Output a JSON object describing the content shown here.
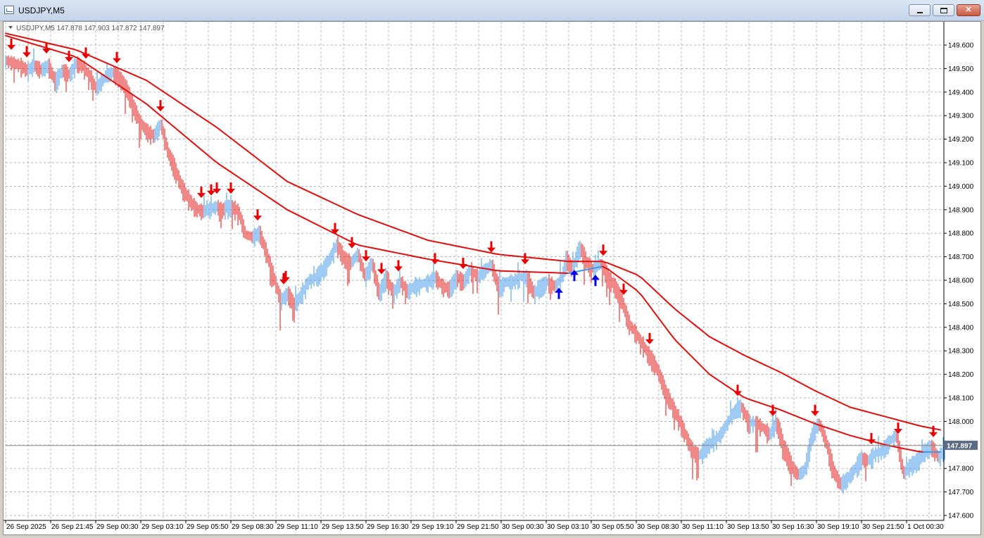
{
  "window": {
    "title": "USDJPY,M5",
    "minimize_label": "‒",
    "maximize_label": "□",
    "close_label": "✕"
  },
  "chart_data": {
    "type": "bar",
    "symbol_info": "USDJPY,M5",
    "ohlc_text": "147.878 147.903 147.872 147.897",
    "bid": "147.897",
    "ylim": [
      147.6,
      149.65
    ],
    "yticks": [
      "149.600",
      "149.500",
      "149.400",
      "149.300",
      "149.200",
      "149.100",
      "149.000",
      "148.900",
      "148.800",
      "148.700",
      "148.600",
      "148.500",
      "148.400",
      "148.300",
      "148.200",
      "148.100",
      "148.000",
      "147.900",
      "147.800",
      "147.700",
      "147.600"
    ],
    "xticks": [
      "26 Sep 2025",
      "26 Sep 21:45",
      "29 Sep 00:30",
      "29 Sep 03:10",
      "29 Sep 05:50",
      "29 Sep 08:30",
      "29 Sep 11:10",
      "29 Sep 13:50",
      "29 Sep 16:30",
      "29 Sep 19:10",
      "29 Sep 21:50",
      "30 Sep 00:30",
      "30 Sep 03:10",
      "30 Sep 05:50",
      "30 Sep 08:30",
      "30 Sep 11:10",
      "30 Sep 13:50",
      "30 Sep 16:30",
      "30 Sep 19:10",
      "30 Sep 21:50",
      "1 Oct 00:30"
    ],
    "price_path": [
      [
        0,
        149.54
      ],
      [
        10,
        149.53
      ],
      [
        20,
        149.52
      ],
      [
        30,
        149.5
      ],
      [
        40,
        149.52
      ],
      [
        50,
        149.5
      ],
      [
        60,
        149.52
      ],
      [
        70,
        149.45
      ],
      [
        80,
        149.5
      ],
      [
        90,
        149.48
      ],
      [
        100,
        149.53
      ],
      [
        110,
        149.51
      ],
      [
        120,
        149.47
      ],
      [
        128,
        149.42
      ],
      [
        135,
        149.45
      ],
      [
        145,
        149.48
      ],
      [
        152,
        149.49
      ],
      [
        160,
        149.47
      ],
      [
        170,
        149.43
      ],
      [
        180,
        149.35
      ],
      [
        190,
        149.28
      ],
      [
        200,
        149.24
      ],
      [
        210,
        149.22
      ],
      [
        220,
        149.27
      ],
      [
        230,
        149.15
      ],
      [
        240,
        149.08
      ],
      [
        250,
        149.0
      ],
      [
        260,
        148.95
      ],
      [
        270,
        148.91
      ],
      [
        280,
        148.9
      ],
      [
        290,
        148.91
      ],
      [
        300,
        148.92
      ],
      [
        310,
        148.91
      ],
      [
        320,
        148.92
      ],
      [
        330,
        148.9
      ],
      [
        340,
        148.8
      ],
      [
        350,
        148.79
      ],
      [
        360,
        148.81
      ],
      [
        370,
        148.72
      ],
      [
        380,
        148.62
      ],
      [
        390,
        148.52
      ],
      [
        400,
        148.55
      ],
      [
        410,
        148.5
      ],
      [
        420,
        148.55
      ],
      [
        430,
        148.6
      ],
      [
        440,
        148.62
      ],
      [
        450,
        148.65
      ],
      [
        460,
        148.7
      ],
      [
        470,
        148.76
      ],
      [
        480,
        148.7
      ],
      [
        490,
        148.68
      ],
      [
        500,
        148.72
      ],
      [
        510,
        148.62
      ],
      [
        520,
        148.68
      ],
      [
        530,
        148.55
      ],
      [
        540,
        148.62
      ],
      [
        550,
        148.55
      ],
      [
        560,
        148.6
      ],
      [
        570,
        148.56
      ],
      [
        580,
        148.58
      ],
      [
        590,
        148.59
      ],
      [
        600,
        148.6
      ],
      [
        610,
        148.62
      ],
      [
        620,
        148.58
      ],
      [
        630,
        148.57
      ],
      [
        640,
        148.62
      ],
      [
        650,
        148.6
      ],
      [
        660,
        148.65
      ],
      [
        670,
        148.62
      ],
      [
        680,
        148.65
      ],
      [
        690,
        148.67
      ],
      [
        700,
        148.57
      ],
      [
        710,
        148.6
      ],
      [
        720,
        148.6
      ],
      [
        730,
        148.62
      ],
      [
        740,
        148.62
      ],
      [
        750,
        148.55
      ],
      [
        760,
        148.58
      ],
      [
        770,
        148.6
      ],
      [
        780,
        148.58
      ],
      [
        790,
        148.62
      ],
      [
        796,
        148.7
      ],
      [
        805,
        148.65
      ],
      [
        815,
        148.75
      ],
      [
        825,
        148.68
      ],
      [
        835,
        148.65
      ],
      [
        845,
        148.68
      ],
      [
        855,
        148.62
      ],
      [
        865,
        148.58
      ],
      [
        875,
        148.52
      ],
      [
        885,
        148.42
      ],
      [
        895,
        148.38
      ],
      [
        905,
        148.33
      ],
      [
        915,
        148.28
      ],
      [
        925,
        148.23
      ],
      [
        935,
        148.15
      ],
      [
        945,
        148.08
      ],
      [
        955,
        148.02
      ],
      [
        965,
        147.95
      ],
      [
        975,
        147.88
      ],
      [
        985,
        147.86
      ],
      [
        995,
        147.9
      ],
      [
        1005,
        147.92
      ],
      [
        1015,
        147.95
      ],
      [
        1025,
        148.0
      ],
      [
        1035,
        148.05
      ],
      [
        1045,
        148.07
      ],
      [
        1055,
        148.0
      ],
      [
        1065,
        148.0
      ],
      [
        1075,
        147.98
      ],
      [
        1085,
        147.95
      ],
      [
        1095,
        148.0
      ],
      [
        1105,
        147.9
      ],
      [
        1115,
        147.82
      ],
      [
        1125,
        147.78
      ],
      [
        1135,
        147.8
      ],
      [
        1145,
        147.95
      ],
      [
        1155,
        148.0
      ],
      [
        1165,
        147.92
      ],
      [
        1175,
        147.8
      ],
      [
        1185,
        147.74
      ],
      [
        1195,
        147.76
      ],
      [
        1205,
        147.8
      ],
      [
        1215,
        147.85
      ],
      [
        1225,
        147.84
      ],
      [
        1235,
        147.87
      ],
      [
        1245,
        147.88
      ],
      [
        1255,
        147.92
      ],
      [
        1265,
        147.95
      ],
      [
        1275,
        147.78
      ],
      [
        1285,
        147.82
      ],
      [
        1295,
        147.84
      ],
      [
        1305,
        147.88
      ],
      [
        1315,
        147.9
      ],
      [
        1325,
        147.85
      ],
      [
        1335,
        147.9
      ]
    ],
    "ma_fast": [
      [
        0,
        149.64
      ],
      [
        100,
        149.55
      ],
      [
        200,
        149.35
      ],
      [
        300,
        149.1
      ],
      [
        400,
        148.9
      ],
      [
        500,
        148.75
      ],
      [
        600,
        148.69
      ],
      [
        700,
        148.64
      ],
      [
        800,
        148.63
      ],
      [
        850,
        148.66
      ],
      [
        900,
        148.55
      ],
      [
        950,
        148.35
      ],
      [
        1000,
        148.2
      ],
      [
        1050,
        148.1
      ],
      [
        1100,
        148.05
      ],
      [
        1150,
        147.99
      ],
      [
        1200,
        147.94
      ],
      [
        1250,
        147.9
      ],
      [
        1300,
        147.87
      ],
      [
        1335,
        147.87
      ]
    ],
    "ma_slow": [
      [
        0,
        149.65
      ],
      [
        100,
        149.58
      ],
      [
        200,
        149.45
      ],
      [
        300,
        149.25
      ],
      [
        400,
        149.02
      ],
      [
        500,
        148.88
      ],
      [
        600,
        148.77
      ],
      [
        700,
        148.71
      ],
      [
        800,
        148.68
      ],
      [
        850,
        148.68
      ],
      [
        900,
        148.62
      ],
      [
        950,
        148.48
      ],
      [
        1000,
        148.36
      ],
      [
        1050,
        148.28
      ],
      [
        1100,
        148.21
      ],
      [
        1150,
        148.13
      ],
      [
        1200,
        148.06
      ],
      [
        1250,
        148.02
      ],
      [
        1300,
        147.98
      ],
      [
        1335,
        147.96
      ]
    ],
    "signals_down": [
      8,
      30,
      58,
      90,
      114,
      158,
      220,
      278,
      292,
      300,
      320,
      358,
      395,
      398,
      468,
      492,
      512,
      534,
      558,
      610,
      650,
      690,
      738,
      849,
      878,
      915,
      1040,
      1090,
      1150,
      1230,
      1268,
      1318
    ],
    "signals_up": [
      786,
      808,
      838
    ],
    "colors": {
      "up_bar": "#3e96e8",
      "down_bar": "#e01010",
      "ma": "#e01010",
      "ma_up": "#3e96e8",
      "arrow_down": "#e60000",
      "arrow_up": "#0000e6",
      "grid": "#9a9a9a"
    }
  }
}
